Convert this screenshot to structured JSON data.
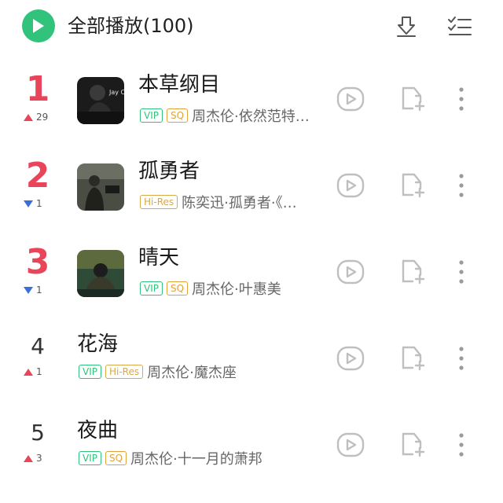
{
  "header": {
    "play_all_label": "全部播放(100)",
    "icons": [
      "play-icon",
      "download-icon",
      "multi-select-icon"
    ]
  },
  "colors": {
    "accent": "#31c27c",
    "rank_top": "#e8455a",
    "trend_up": "#e8455a",
    "trend_down": "#3a6fd8"
  },
  "songs": [
    {
      "rank": "1",
      "trend": "29",
      "trend_dir": "up",
      "title": "本草纲目",
      "badges": [
        "VIP",
        "SQ"
      ],
      "artist": "周杰伦·依然范特…",
      "cover_text": "Jay Chou"
    },
    {
      "rank": "2",
      "trend": "1",
      "trend_dir": "down",
      "title": "孤勇者",
      "badges": [
        "Hi-Res"
      ],
      "artist": "陈奕迅·孤勇者·《…",
      "cover_text": ""
    },
    {
      "rank": "3",
      "trend": "1",
      "trend_dir": "down",
      "title": "晴天",
      "badges": [
        "VIP",
        "SQ"
      ],
      "artist": "周杰伦·叶惠美",
      "cover_text": ""
    },
    {
      "rank": "4",
      "trend": "1",
      "trend_dir": "up",
      "title": "花海",
      "badges": [
        "VIP",
        "Hi-Res"
      ],
      "artist": "周杰伦·魔杰座",
      "cover_text": ""
    },
    {
      "rank": "5",
      "trend": "3",
      "trend_dir": "up",
      "title": "夜曲",
      "badges": [
        "VIP",
        "SQ"
      ],
      "artist": "周杰伦·十一月的萧邦",
      "cover_text": ""
    }
  ]
}
